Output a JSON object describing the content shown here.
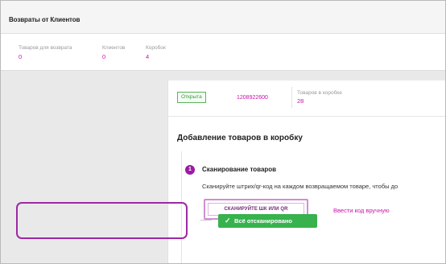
{
  "header": {
    "title": "Возвраты от Клиентов"
  },
  "stats": [
    {
      "label": "Товаров для возврата",
      "value": "0"
    },
    {
      "label": "Клиентов",
      "value": "0"
    },
    {
      "label": "Коробок",
      "value": "4"
    }
  ],
  "box": {
    "status": "Открыта",
    "number": "1208922600",
    "items_label": "Товаров в коробке",
    "items_value": "28"
  },
  "section": {
    "title": "Добавление товаров в коробку",
    "step_number": "1",
    "step_title": "Сканирование товаров",
    "step_description": "Сканируйте штрих/qr-код на каждом возвращаемом товаре, чтобы до",
    "scan_button": "СКАНИРУЙТЕ ШК ИЛИ QR",
    "manual_link": "Ввести код вручную",
    "done_button": "Всё отсканировано"
  },
  "colors": {
    "accent": "#cb11ab",
    "success": "#37b24d",
    "highlight": "#9b2aa3"
  }
}
